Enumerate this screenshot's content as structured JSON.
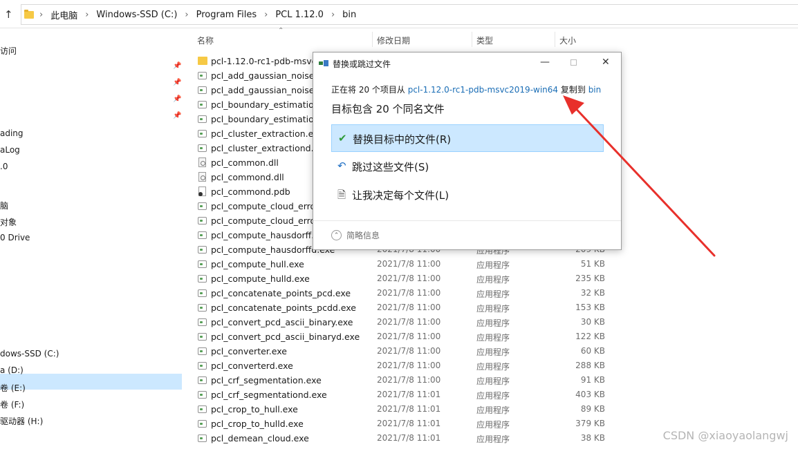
{
  "address": {
    "crumbs": [
      "此电脑",
      "Windows-SSD (C:)",
      "Program Files",
      "PCL 1.12.0",
      "bin"
    ]
  },
  "nav": {
    "items": [
      "访问",
      "ading",
      "aLog",
      ".0",
      "",
      "脑",
      "对象",
      "0 Drive",
      "dows-SSD (C:)",
      "a (D:)",
      "卷 (E:)",
      "卷 (F:)",
      "驱动器 (H:)"
    ]
  },
  "columns": {
    "name": "名称",
    "date": "修改日期",
    "type": "类型",
    "size": "大小"
  },
  "files": [
    {
      "icon": "folder",
      "name": "pcl-1.12.0-rc1-pdb-msvc2019-win64",
      "date": "",
      "type": "",
      "size": ""
    },
    {
      "icon": "exe",
      "name": "pcl_add_gaussian_noise.exe",
      "date": "",
      "type": "",
      "size": ""
    },
    {
      "icon": "exe",
      "name": "pcl_add_gaussian_noised.exe",
      "date": "",
      "type": "",
      "size": ""
    },
    {
      "icon": "exe",
      "name": "pcl_boundary_estimation.exe",
      "date": "",
      "type": "",
      "size": ""
    },
    {
      "icon": "exe",
      "name": "pcl_boundary_estimationd.exe",
      "date": "",
      "type": "",
      "size": ""
    },
    {
      "icon": "exe",
      "name": "pcl_cluster_extraction.exe",
      "date": "",
      "type": "",
      "size": ""
    },
    {
      "icon": "exe",
      "name": "pcl_cluster_extractiond.exe",
      "date": "",
      "type": "",
      "size": ""
    },
    {
      "icon": "dll",
      "name": "pcl_common.dll",
      "date": "",
      "type": "",
      "size": ""
    },
    {
      "icon": "dll",
      "name": "pcl_commond.dll",
      "date": "",
      "type": "",
      "size": ""
    },
    {
      "icon": "pdb",
      "name": "pcl_commond.pdb",
      "date": "",
      "type": "",
      "size": ""
    },
    {
      "icon": "exe",
      "name": "pcl_compute_cloud_error.exe",
      "date": "",
      "type": "",
      "size": ""
    },
    {
      "icon": "exe",
      "name": "pcl_compute_cloud_errord.exe",
      "date": "",
      "type": "",
      "size": ""
    },
    {
      "icon": "exe",
      "name": "pcl_compute_hausdorff.exe",
      "date": "",
      "type": "",
      "size": ""
    },
    {
      "icon": "exe",
      "name": "pcl_compute_hausdorffd.exe",
      "date": "2021/7/8 11:00",
      "type": "应用程序",
      "size": "209 KB"
    },
    {
      "icon": "exe",
      "name": "pcl_compute_hull.exe",
      "date": "2021/7/8 11:00",
      "type": "应用程序",
      "size": "51 KB"
    },
    {
      "icon": "exe",
      "name": "pcl_compute_hulld.exe",
      "date": "2021/7/8 11:00",
      "type": "应用程序",
      "size": "235 KB"
    },
    {
      "icon": "exe",
      "name": "pcl_concatenate_points_pcd.exe",
      "date": "2021/7/8 11:00",
      "type": "应用程序",
      "size": "32 KB"
    },
    {
      "icon": "exe",
      "name": "pcl_concatenate_points_pcdd.exe",
      "date": "2021/7/8 11:00",
      "type": "应用程序",
      "size": "153 KB"
    },
    {
      "icon": "exe",
      "name": "pcl_convert_pcd_ascii_binary.exe",
      "date": "2021/7/8 11:00",
      "type": "应用程序",
      "size": "30 KB"
    },
    {
      "icon": "exe",
      "name": "pcl_convert_pcd_ascii_binaryd.exe",
      "date": "2021/7/8 11:00",
      "type": "应用程序",
      "size": "122 KB"
    },
    {
      "icon": "exe",
      "name": "pcl_converter.exe",
      "date": "2021/7/8 11:00",
      "type": "应用程序",
      "size": "60 KB"
    },
    {
      "icon": "exe",
      "name": "pcl_converterd.exe",
      "date": "2021/7/8 11:00",
      "type": "应用程序",
      "size": "288 KB"
    },
    {
      "icon": "exe",
      "name": "pcl_crf_segmentation.exe",
      "date": "2021/7/8 11:00",
      "type": "应用程序",
      "size": "91 KB"
    },
    {
      "icon": "exe",
      "name": "pcl_crf_segmentationd.exe",
      "date": "2021/7/8 11:01",
      "type": "应用程序",
      "size": "403 KB"
    },
    {
      "icon": "exe",
      "name": "pcl_crop_to_hull.exe",
      "date": "2021/7/8 11:01",
      "type": "应用程序",
      "size": "89 KB"
    },
    {
      "icon": "exe",
      "name": "pcl_crop_to_hulld.exe",
      "date": "2021/7/8 11:01",
      "type": "应用程序",
      "size": "379 KB"
    },
    {
      "icon": "exe",
      "name": "pcl_demean_cloud.exe",
      "date": "2021/7/8 11:01",
      "type": "应用程序",
      "size": "38 KB"
    }
  ],
  "dialog": {
    "title": "替换或跳过文件",
    "copy_prefix": "正在将 20 个项目从 ",
    "source": "pcl-1.12.0-rc1-pdb-msvc2019-win64",
    "copy_mid": " 复制到 ",
    "target": "bin",
    "dest_msg": "目标包含 20 个同名文件",
    "options": [
      {
        "label": "替换目标中的文件(R)",
        "icon": "check-icon"
      },
      {
        "label": "跳过这些文件(S)",
        "icon": "skip-arrow-icon"
      },
      {
        "label": "让我决定每个文件(L)",
        "icon": "decide-file-icon"
      }
    ],
    "details": "简略信息",
    "close": "✕",
    "minimize": "—"
  },
  "watermark": "CSDN @xiaoyaolangwj"
}
